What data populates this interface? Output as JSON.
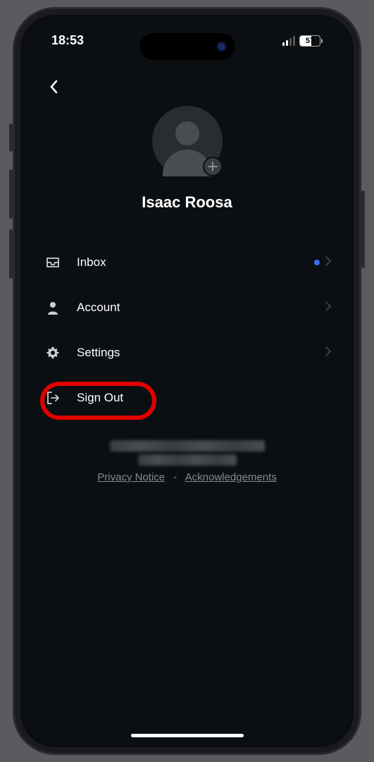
{
  "status": {
    "time": "18:53",
    "battery_pct": "57"
  },
  "profile": {
    "name": "Isaac Roosa"
  },
  "menu": {
    "inbox": "Inbox",
    "account": "Account",
    "settings": "Settings",
    "signout": "Sign Out"
  },
  "footer": {
    "privacy": "Privacy Notice",
    "separator": "-",
    "ack": "Acknowledgements"
  }
}
